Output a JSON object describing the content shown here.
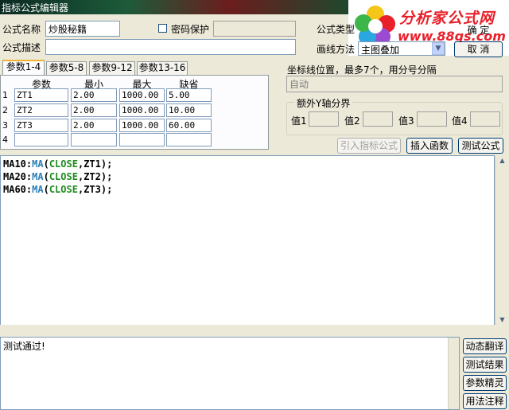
{
  "window": {
    "title": "指标公式编辑器"
  },
  "logo": {
    "brand": "分析家公式网",
    "url": "www.88gs.com"
  },
  "form": {
    "name_label": "公式名称",
    "name_value": "炒股秘籍",
    "password_label": "密码保护",
    "password_value": "",
    "type_label": "公式类型",
    "desc_label": "公式描述",
    "desc_value": "",
    "draw_label": "画线方法",
    "draw_value": "主图叠加",
    "ok_label": "确 定",
    "cancel_label": "取 消"
  },
  "tabs": [
    "参数1-4",
    "参数5-8",
    "参数9-12",
    "参数13-16"
  ],
  "params": {
    "headers": [
      "参数",
      "最小",
      "最大",
      "缺省"
    ],
    "rows": [
      {
        "n": "1",
        "name": "ZT1",
        "min": "2.00",
        "max": "1000.00",
        "def": "5.00"
      },
      {
        "n": "2",
        "name": "ZT2",
        "min": "2.00",
        "max": "1000.00",
        "def": "10.00"
      },
      {
        "n": "3",
        "name": "ZT3",
        "min": "2.00",
        "max": "1000.00",
        "def": "60.00"
      },
      {
        "n": "4",
        "name": "",
        "min": "",
        "max": "",
        "def": ""
      }
    ]
  },
  "axis": {
    "label": "坐标线位置，最多7个，用分号分隔",
    "value": "自动",
    "group_label": "额外Y轴分界",
    "v1": "值1",
    "v2": "值2",
    "v3": "值3",
    "v4": "值4"
  },
  "actions": {
    "import": "引入指标公式",
    "insert": "插入函数",
    "test": "测试公式"
  },
  "code": [
    {
      "var": "MA10",
      "fn": "MA",
      "arg": "CLOSE",
      "param": "ZT1"
    },
    {
      "var": "MA20",
      "fn": "MA",
      "arg": "CLOSE",
      "param": "ZT2"
    },
    {
      "var": "MA60",
      "fn": "MA",
      "arg": "CLOSE",
      "param": "ZT3"
    }
  ],
  "output": {
    "text": "测试通过!"
  },
  "side_buttons": [
    "动态翻译",
    "测试结果",
    "参数精灵",
    "用法注释"
  ]
}
